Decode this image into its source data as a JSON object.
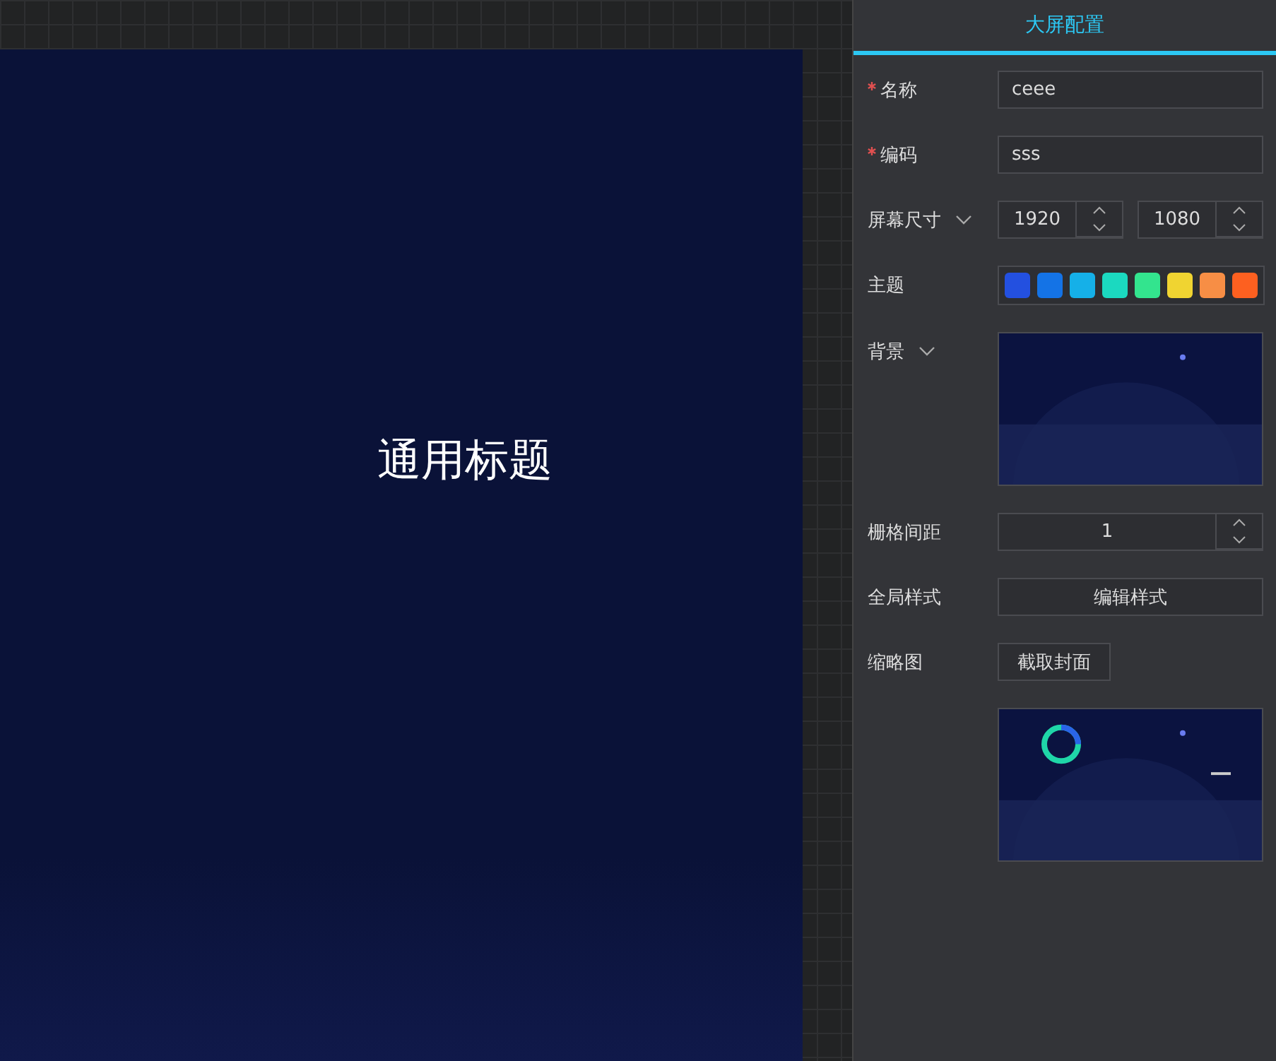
{
  "canvas": {
    "title": "通用标题"
  },
  "panel": {
    "tab": "大屏配置",
    "fields": [
      {
        "kind": "text",
        "label": "名称",
        "required": true,
        "value": "ceee"
      },
      {
        "kind": "text",
        "label": "编码",
        "required": true,
        "value": "sss"
      },
      {
        "kind": "size",
        "label": "屏幕尺寸",
        "expandable": true,
        "values": [
          "1920",
          "1080"
        ]
      },
      {
        "kind": "theme",
        "label": "主题",
        "colors": [
          {
            "color": "#2350e0"
          },
          {
            "color": "#1473e6"
          },
          {
            "color": "#15b0e8"
          },
          {
            "color": "#1bd9c0"
          },
          {
            "color": "#33e48e"
          },
          {
            "color": "#f0d431"
          },
          {
            "color": "#f78e45"
          },
          {
            "color": "#fd6020"
          }
        ]
      },
      {
        "kind": "image",
        "label": "背景",
        "expandable": true
      },
      {
        "kind": "number",
        "label": "栅格间距",
        "value": "1"
      },
      {
        "kind": "button",
        "label": "全局样式",
        "button": "编辑样式"
      },
      {
        "kind": "thumbnail",
        "label": "缩略图",
        "button": "截取封面"
      }
    ]
  }
}
